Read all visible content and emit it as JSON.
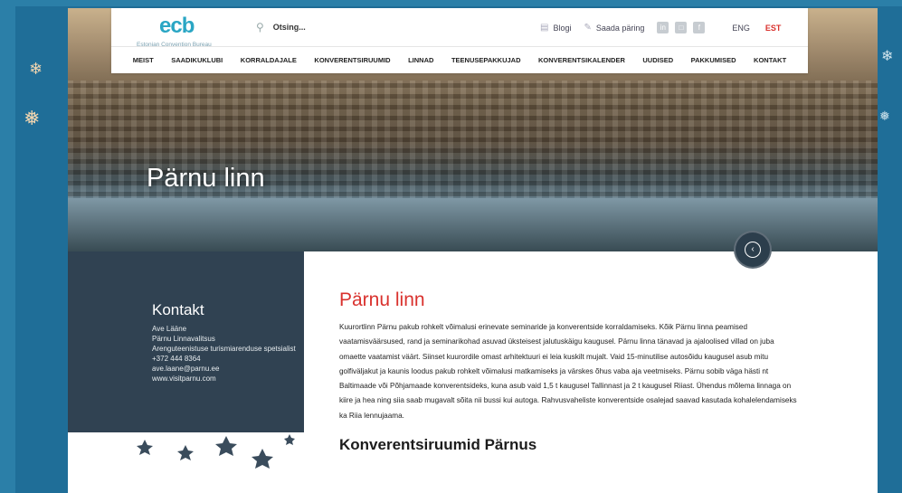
{
  "header": {
    "logo_mark": "ecb",
    "logo_subtitle": "Estonian Convention Bureau",
    "search_placeholder": "Otsing...",
    "links": {
      "blog": "Blogi",
      "request": "Saada päring"
    },
    "lang": [
      "ENG",
      "EST"
    ]
  },
  "nav": [
    "MEIST",
    "SAADIKUKLUBI",
    "KORRALDAJALE",
    "KONVERENTSIRUUMID",
    "LINNAD",
    "TEENUSEPAKKUJAD",
    "KONVERENTSIKALENDER",
    "UUDISED",
    "PAKKUMISED",
    "KONTAKT"
  ],
  "hero": {
    "title": "Pärnu linn"
  },
  "contact": {
    "heading": "Kontakt",
    "lines": [
      "Ave Lääne",
      "Pärnu Linnavalitsus",
      "Arenguteenistuse turismiarenduse spetsialist",
      "+372 444 8364",
      "ave.laane@parnu.ee",
      "www.visitparnu.com"
    ]
  },
  "content": {
    "title": "Pärnu linn",
    "body": "Kuurortlinn Pärnu pakub rohkelt võimalusi erinevate seminaride ja konverentside korraldamiseks. Kõik Pärnu linna peamised vaatamisväärsused, rand ja seminarikohad asuvad üksteisest jalutuskäigu kaugusel. Pärnu linna tänavad ja ajaloolised villad on juba omaette vaatamist väärt. Siinset kuurordile omast arhitektuuri ei leia kuskilt mujalt.  Vaid 15-minutilise autosõidu kaugusel asub mitu golfiväljakut ja kaunis loodus pakub rohkelt võimalusi matkamiseks ja värskes õhus vaba aja veetmiseks. Pärnu sobib väga hästi nt Baltimaade või Põhjamaade konverentsideks, kuna asub vaid 1,5 t kaugusel Tallinnast ja 2 t kaugusel Riiast. Ühendus mõlema linnaga on kiire ja hea ning siia saab mugavalt sõita nii bussi kui autoga. Rahvusvaheliste konverentside osalejad saavad kasutada kohalelendamiseks ka Riia lennujaama.",
    "subheading": "Konverentsiruumid Pärnus"
  },
  "colors": {
    "accent": "#d9322e",
    "sidebar": "#304252",
    "background": "#2b7fa8",
    "logo": "#2aa6c4"
  },
  "icons": [
    "search-icon",
    "blog-icon",
    "edit-icon",
    "linkedin-icon",
    "instagram-icon",
    "facebook-icon",
    "back-icon",
    "snowflake-icon"
  ]
}
